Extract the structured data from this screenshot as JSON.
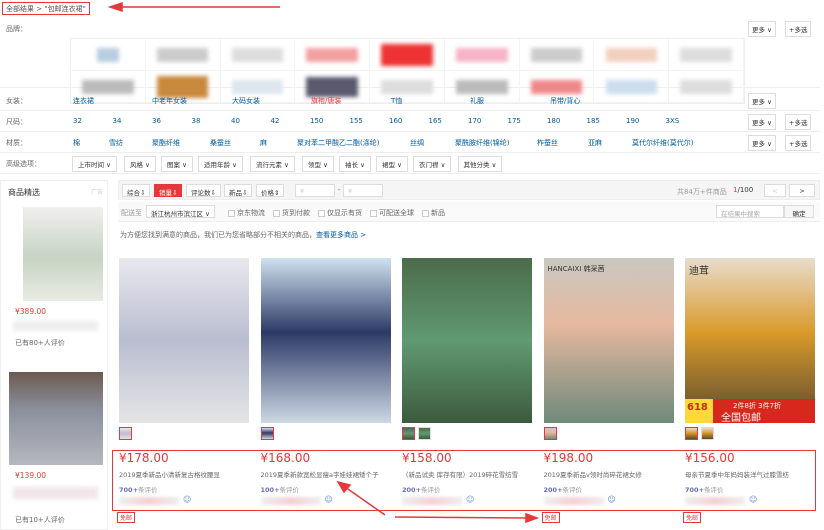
{
  "breadcrumb": {
    "root": "全部结果",
    "sep": ">",
    "keyword": "\"包邮连衣裙\""
  },
  "filters": {
    "brand_label": "品牌：",
    "more": "更多",
    "multi": "+多选",
    "category_label": "女装：",
    "categories": [
      "连衣裙",
      "中老年女装",
      "大码女装",
      "旗袍/唐装",
      "T恤",
      "礼服",
      "吊带/背心"
    ],
    "size_label": "尺码：",
    "sizes": [
      "32",
      "34",
      "36",
      "38",
      "40",
      "42",
      "150",
      "155",
      "160",
      "165",
      "170",
      "175",
      "180",
      "185",
      "190",
      "3XS"
    ],
    "material_label": "材质：",
    "materials": [
      "棉",
      "雪纺",
      "聚酯纤维",
      "桑蚕丝",
      "麻",
      "聚对苯二甲酸乙二酯(涤纶)",
      "丝绸",
      "聚酰胺纤维(锦纶)",
      "柞蚕丝",
      "亚麻",
      "莫代尔纤维(莫代尔)"
    ],
    "advanced_label": "高级选项：",
    "advanced": [
      "上市时间",
      "风格",
      "图案",
      "适用年龄",
      "流行元素",
      "领型",
      "袖长",
      "裙型",
      "衣门襟",
      "其他分类"
    ]
  },
  "left_panel": {
    "title": "商品精选",
    "ad": "广告",
    "items": [
      {
        "price": "¥389.00",
        "reviews": "已有80+人评价"
      },
      {
        "price": "¥139.00",
        "reviews": "已有10+人评价"
      }
    ]
  },
  "sort": {
    "options": [
      "综合⇩",
      "销量⇩",
      "评论数⇩",
      "新品⇩",
      "价格⇕"
    ],
    "price_from": "¥",
    "price_to": "¥",
    "dash": "-",
    "total": "共84万+件商品",
    "page": "1",
    "pages": "/100",
    "prev": "<",
    "next": ">"
  },
  "ship": {
    "label": "配送至",
    "location": "浙江杭州市滨江区",
    "checks": [
      "京东物流",
      "货到付款",
      "仅显示有货",
      "可配送全球",
      "新品"
    ],
    "search_placeholder": "在结果中搜索",
    "confirm": "确定"
  },
  "notice": {
    "text": "为方便您找到满意的商品，我们已为您省略部分不相关的商品，",
    "link": "查看更多商品 >"
  },
  "products": [
    {
      "price": "¥178.00",
      "title": "2019夏季新品小清新复古格纹腰显",
      "reviews_num": "700+",
      "reviews_label": "条评价",
      "free": "免邮"
    },
    {
      "price": "¥168.00",
      "title": "2019夏季新款宽松显瘦a字娃娃裙矮个子",
      "reviews_num": "100+",
      "reviews_label": "条评价",
      "free": ""
    },
    {
      "price": "¥158.00",
      "title": "（新品试卖 库存有限）2019碎花雪纺雪",
      "reviews_num": "200+",
      "reviews_label": "条评价",
      "free": ""
    },
    {
      "price": "¥198.00",
      "title": "2019夏季新品v领时尚碎花裙女修",
      "reviews_num": "200+",
      "reviews_label": "条评价",
      "free": "免邮"
    },
    {
      "price": "¥156.00",
      "title": "母亲节夏季中年妈妈装洋气过膝雪纺",
      "reviews_num": "700+",
      "reviews_label": "条评价",
      "free": "免邮"
    }
  ],
  "image_text": {
    "brand4": "HANCAIXI 韩采茜",
    "brand5": "迪茸",
    "promo618": "618",
    "promo1": "2件8折 3件7折",
    "promo2": "全国包邮"
  },
  "colors": {
    "accent": "#e4393c",
    "link": "#005aa0"
  }
}
